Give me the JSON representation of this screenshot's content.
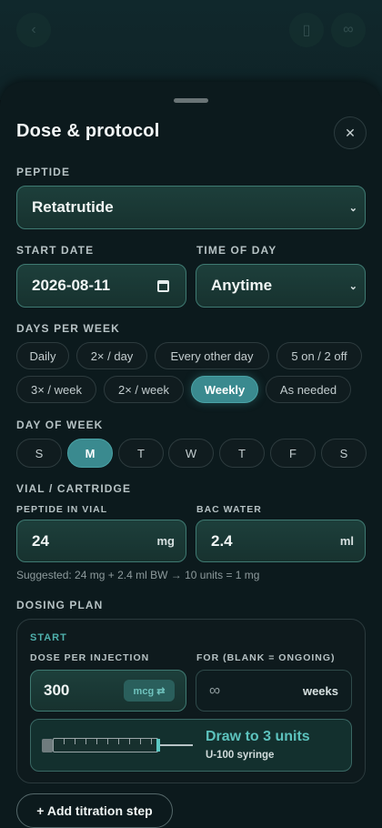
{
  "sheet": {
    "title": "Dose & protocol",
    "close_icon": "close-icon"
  },
  "peptide": {
    "label": "PEPTIDE",
    "value": "Retatrutide"
  },
  "start_date": {
    "label": "START DATE",
    "value": "2026-08-11"
  },
  "time_of_day": {
    "label": "TIME OF DAY",
    "value": "Anytime"
  },
  "days_per_week": {
    "label": "DAYS PER WEEK",
    "options": [
      "Daily",
      "2× / day",
      "Every other day",
      "5 on / 2 off",
      "3× / week",
      "2× / week",
      "Weekly",
      "As needed"
    ],
    "selected": "Weekly"
  },
  "day_of_week": {
    "label": "DAY OF WEEK",
    "days": [
      "S",
      "M",
      "T",
      "W",
      "T",
      "F",
      "S"
    ],
    "selected_index": 1
  },
  "vial": {
    "label": "VIAL / CARTRIDGE",
    "peptide_label": "PEPTIDE IN VIAL",
    "peptide_value": "24",
    "peptide_unit": "mg",
    "bac_label": "BAC WATER",
    "bac_value": "2.4",
    "bac_unit": "ml",
    "suggestion": "Suggested: 24 mg + 2.4 ml BW → 10 units = 1 mg"
  },
  "dosing_plan": {
    "label": "DOSING PLAN",
    "start_label": "START",
    "dose_label": "DOSE PER INJECTION",
    "dose_value": "300",
    "dose_unit": "mcg ⇄",
    "for_label": "FOR (BLANK = ONGOING)",
    "for_value": "∞",
    "for_unit": "weeks",
    "draw_text": "Draw to 3 units",
    "syringe_text": "U-100 syringe"
  },
  "add_step_label": "+ Add titration step",
  "colors": {
    "accent": "#3a8a8f",
    "field_border": "#3f7a72",
    "background": "#0c1a1d",
    "draw_text": "#5cc2bd"
  }
}
